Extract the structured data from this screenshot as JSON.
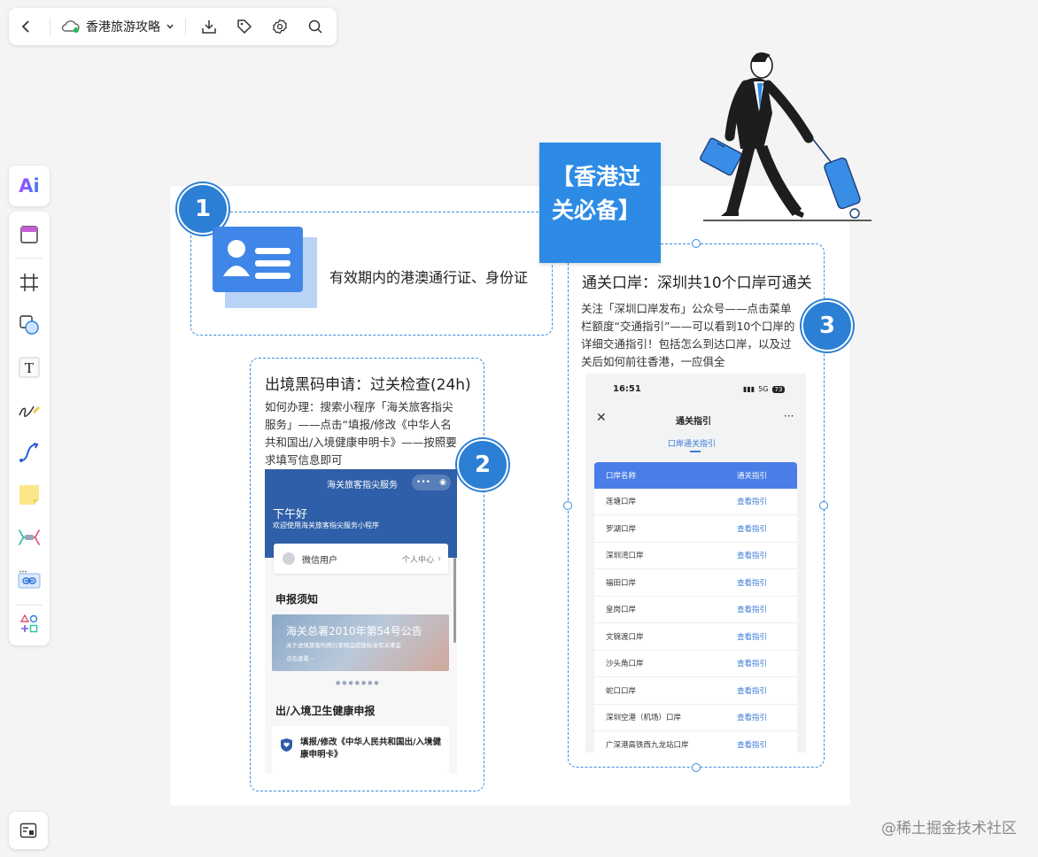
{
  "toolbar": {
    "title": "香港旅游攻略"
  },
  "left_toolbar": {
    "ai_label": "Ai",
    "tools": [
      "template-icon",
      "frame-icon",
      "shape-icon",
      "text-icon",
      "pen-icon",
      "connector-icon",
      "sticky-note-icon",
      "mindmap-icon",
      "link-card-icon",
      "more-shapes-icon"
    ]
  },
  "board": {
    "banner_title": "【香港过关必备】",
    "section1": {
      "number": "1",
      "text": "有效期内的港澳通行证、身份证"
    },
    "section2": {
      "number": "2",
      "heading": "出境黑码申请：过关检查(24h)",
      "body": "如何办理：搜索小程序「海关旅客指尖服务」——点击“填报/修改《中华人名共和国出/入境健康申明卡》——按照要求填写信息即可",
      "phone": {
        "app_title": "海关旅客指尖服务",
        "greeting": "下午好",
        "welcome": "欢迎使用海关旅客指尖服务小程序",
        "user": "微信用户",
        "user_center": "个人中心",
        "notice_title": "申报须知",
        "banner_text": "海关总署2010年第54号公告",
        "banner_sub": "关于进境旅客所携行李物品验放标准有关事宜",
        "banner_link": "点击查看 ›",
        "health_title": "出/入境卫生健康申报",
        "fill_text": "填报/修改《中华人民共和国出/入境健康申明卡》"
      }
    },
    "section3": {
      "number": "3",
      "heading": "通关口岸：深圳共10个口岸可通关",
      "body": "关注「深圳口岸发布」公众号——点击菜单栏额度“交通指引”——可以看到10个口岸的详细交通指引！包括怎么到达口岸，以及过关后如何前往香港，一应俱全",
      "phone": {
        "time": "16:51",
        "signal": "5G",
        "battery": "73",
        "page_title": "通关指引",
        "tab": "口岸通关指引",
        "col1": "口岸名称",
        "col2": "通关指引",
        "link_text": "查看指引",
        "ports": [
          "莲塘口岸",
          "罗湖口岸",
          "深圳湾口岸",
          "福田口岸",
          "皇岗口岸",
          "文锦渡口岸",
          "沙头角口岸",
          "蛇口口岸",
          "深圳空港（机场）口岸",
          "广深港高铁西九龙站口岸"
        ]
      }
    }
  },
  "watermark": "@稀土掘金技术社区",
  "colors": {
    "accent": "#2d8be6",
    "badge": "#2b7fd5",
    "dash": "#3a8be0"
  }
}
